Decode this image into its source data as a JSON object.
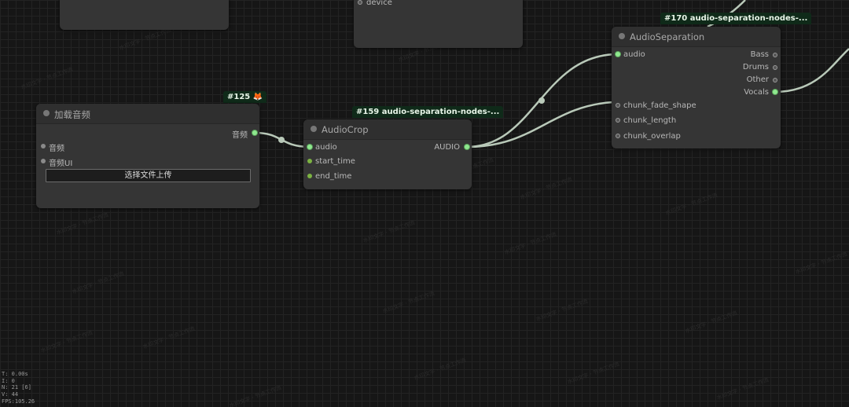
{
  "watermark": "水印文字 · 节点工作流",
  "nodes": {
    "top_left": {},
    "device_node": {
      "slot_label": "device"
    },
    "load_audio": {
      "badge": "#125 🦊",
      "title": "加载音频",
      "output_label": "音频",
      "widgets": [
        "音频",
        "音频UI"
      ],
      "upload_button": "选择文件上传"
    },
    "audio_crop": {
      "badge": "#159 audio-separation-nodes-...",
      "title": "AudioCrop",
      "inputs": [
        "audio",
        "start_time",
        "end_time"
      ],
      "output_label": "AUDIO"
    },
    "audio_separation": {
      "badge": "#170 audio-separation-nodes-...",
      "title": "AudioSeparation",
      "input_audio": "audio",
      "outputs": [
        "Bass",
        "Drums",
        "Other",
        "Vocals"
      ],
      "widgets": [
        "chunk_fade_shape",
        "chunk_length",
        "chunk_overlap"
      ]
    }
  },
  "stats": {
    "time": "T: 0.00s",
    "iteration": "I: 0",
    "nodes": "N: 21 [6]",
    "vertices": "V: 44",
    "fps": "FPS:105.26"
  },
  "colors": {
    "canvas_bg": "#161616",
    "node_bg": "#353535",
    "wire": "#b9c9b9",
    "slot_active": "#8fe88f",
    "badge_bg": "#0f2a19"
  }
}
